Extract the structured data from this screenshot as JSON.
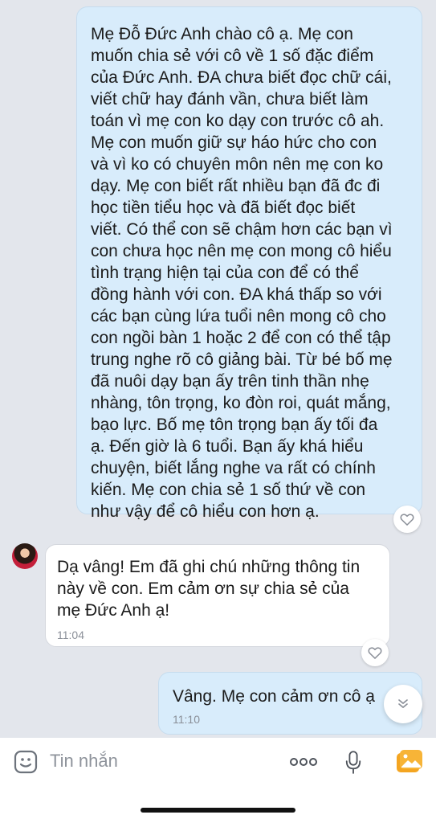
{
  "messages": [
    {
      "id": "out-1",
      "direction": "outgoing",
      "text": "Mẹ Đỗ Đức Anh chào cô ạ. Mẹ con\nmuốn chia sẻ với cô về 1 số đặc điểm\ncủa Đức Anh. ĐA chưa biết đọc chữ cái,\nviết chữ hay đánh vần, chưa biết làm\ntoán vì mẹ con ko dạy con trước cô ah.\nMẹ con muốn giữ sự háo hức cho con\nvà vì ko có chuyên môn nên mẹ con ko\ndạy. Mẹ con biết rất nhiều bạn đã đc đi\nhọc tiền tiểu học và đã biết đọc biết\nviết. Có thể con sẽ chậm hơn các bạn vì\ncon chưa học nên mẹ con mong cô hiểu\ntình trạng hiện tại của con để có thể\nđồng hành với con. ĐA khá thấp so với\ncác bạn cùng lứa tuổi nên mong cô cho\ncon ngồi bàn 1 hoặc 2 để con có thể tập\ntrung nghe rõ cô giảng bài. Từ bé bố mẹ\nđã nuôi dạy bạn ấy trên tinh thần nhẹ\nnhàng, tôn trọng, ko đòn roi, quát mắng,\nbạo lực. Bố mẹ tôn trọng bạn ấy tối đa\nạ. Đến giờ là 6 tuổi. Bạn ấy khá hiểu\nchuyện, biết lắng nghe va rất có chính\nkiến. Mẹ con chia sẻ 1 số thứ về con\nnhư vậy để cô hiểu con hơn ạ."
    },
    {
      "id": "in-1",
      "direction": "incoming",
      "text": "Dạ vâng! Em đã ghi chú những thông tin\nnày về con. Em cảm ơn sự chia sẻ của\nmẹ Đức Anh ạ!",
      "time": "11:04"
    },
    {
      "id": "out-2",
      "direction": "outgoing",
      "text": "Vâng. Mẹ con cảm ơn cô ạ",
      "time": "11:10"
    }
  ],
  "composer": {
    "placeholder": "Tin nhắn"
  },
  "icons": {
    "react": "heart-icon",
    "scroll": "chevron-double-down-icon",
    "sticker": "sticker-icon",
    "more": "more-dots-icon",
    "mic": "microphone-icon",
    "image": "image-icon"
  },
  "colors": {
    "outgoing_bubble": "#d8ecfb",
    "incoming_bubble": "#ffffff",
    "background": "#e3e6ec",
    "image_icon": "#f5a623"
  }
}
